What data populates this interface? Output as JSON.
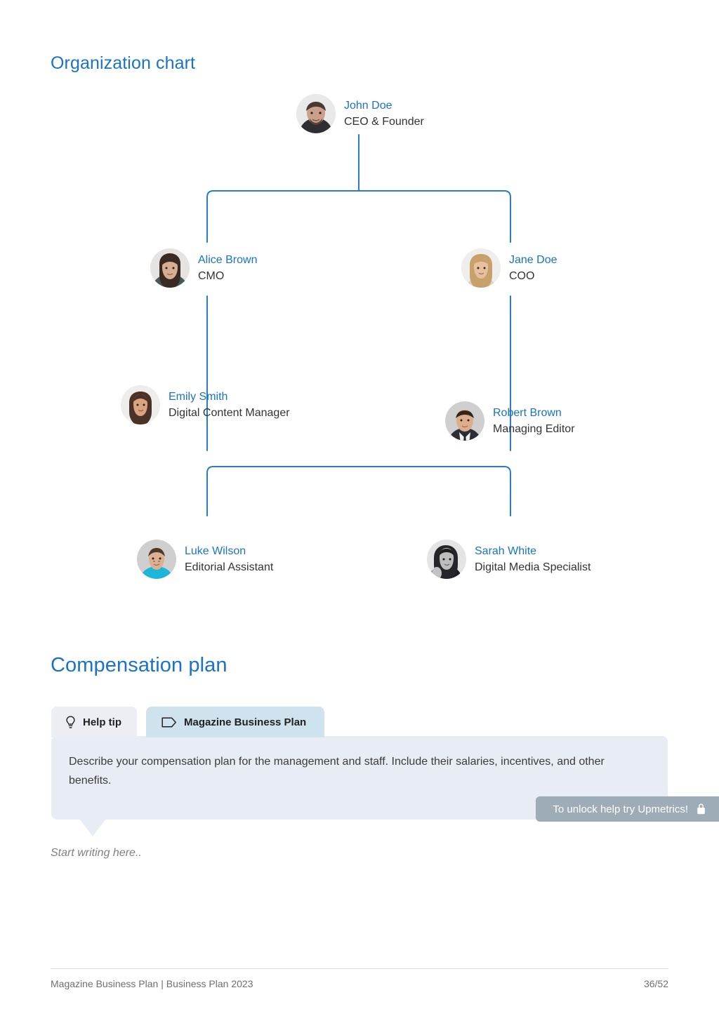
{
  "org_section": {
    "title": "Organization chart",
    "accent_color": "#1a73c7",
    "nodes": [
      {
        "id": "ceo",
        "name": "John Doe",
        "role": "CEO & Founder",
        "avatar": "avatar-john-doe"
      },
      {
        "id": "cmo",
        "name": "Alice Brown",
        "role": "CMO",
        "avatar": "avatar-alice-brown"
      },
      {
        "id": "coo",
        "name": "Jane Doe",
        "role": "COO",
        "avatar": "avatar-jane-doe"
      },
      {
        "id": "dcm",
        "name": "Emily Smith",
        "role": "Digital Content Manager",
        "avatar": "avatar-emily-smith"
      },
      {
        "id": "me",
        "name": "Robert Brown",
        "role": "Managing Editor",
        "avatar": "avatar-robert-brown"
      },
      {
        "id": "ea",
        "name": "Luke Wilson",
        "role": "Editorial Assistant",
        "avatar": "avatar-luke-wilson"
      },
      {
        "id": "dms",
        "name": "Sarah White",
        "role": "Digital Media Specialist",
        "avatar": "avatar-sarah-white"
      }
    ],
    "connector_color": "#2a7dc4"
  },
  "comp_section": {
    "title": "Compensation plan",
    "tabs": [
      {
        "label": "Help tip",
        "icon": "lightbulb-icon",
        "active": false,
        "color": "#eceef4"
      },
      {
        "label": "Magazine Business Plan",
        "icon": "tag-icon",
        "active": true,
        "color": "#cfe3ee"
      }
    ],
    "help_text": "Describe your compensation plan for the management and staff. Include their salaries, incentives, and other benefits.",
    "unlock_badge": {
      "label": "To unlock help try Upmetrics!",
      "icon": "lock-icon",
      "color": "#9dacb7"
    },
    "editor_placeholder": "Start writing here.."
  },
  "footer": {
    "document_label": "Magazine Business Plan | Business Plan 2023",
    "page_number": "36/52"
  }
}
